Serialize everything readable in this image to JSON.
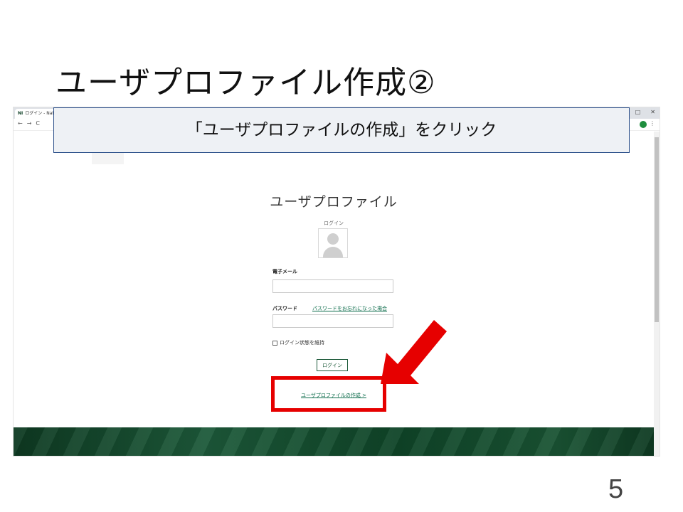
{
  "slide": {
    "title": "ユーザプロファイル作成②",
    "page_number": "5",
    "callout_text": "「ユーザプロファイルの作成」をクリック"
  },
  "browser": {
    "tab_title": "ログイン - Natio",
    "tab_logo": "NI",
    "window_controls": [
      "□",
      "✕"
    ],
    "nav_buttons": [
      "←",
      "→",
      "C"
    ],
    "profile_badge": "●"
  },
  "login_page": {
    "heading": "ユーザプロファイル",
    "subheading": "ログイン",
    "email_label": "電子メール",
    "password_label": "パスワード",
    "forgot_password_link": "パスワードをお忘れになった場合",
    "remember_label": "ログイン状態を維持",
    "login_button": "ログイン",
    "create_profile_link": "ユーザプロファイルの作成 >"
  },
  "colors": {
    "brand_green": "#1d5a3a",
    "highlight_red": "#e60000",
    "callout_border": "#2b4f8a"
  }
}
